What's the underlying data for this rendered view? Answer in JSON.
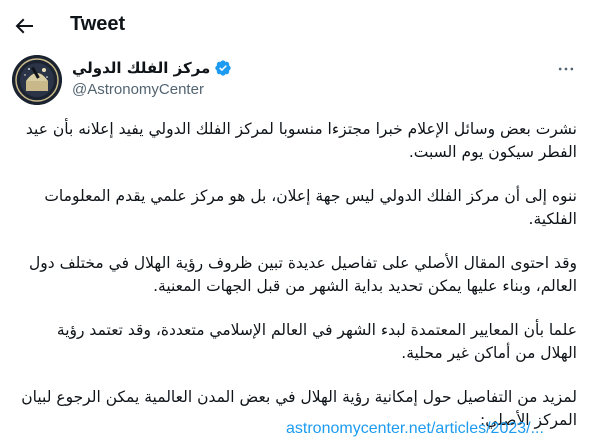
{
  "header": {
    "title": "Tweet",
    "back_icon": "arrow-left-icon"
  },
  "author": {
    "display_name": "مركز الفلك الدولي",
    "handle": "@AstronomyCenter",
    "verified": true,
    "verified_color": "#1d9bf0"
  },
  "tweet": {
    "paragraphs": [
      "نشرت بعض وسائل الإعلام خبرا مجتزءا منسوبا لمركز الفلك الدولي يفيد إعلانه بأن عيد الفطر سيكون يوم السبت.",
      "ننوه إلى أن مركز الفلك الدولي ليس جهة إعلان، بل هو مركز علمي يقدم المعلومات الفلكية.",
      "وقد احتوى المقال الأصلي على تفاصيل عديدة تبين ظروف رؤية الهلال في مختلف دول العالم، وبناء عليها يمكن تحديد بداية الشهر من قبل الجهات المعنية.",
      "علما بأن المعايير المعتمدة لبدء الشهر في العالم الإسلامي متعددة، وقد تعتمد رؤية الهلال من أماكن غير محلية.",
      "لمزيد من التفاصيل حول إمكانية رؤية الهلال في بعض المدن العالمية يمكن الرجوع لبيان المركز الأصلي:"
    ],
    "link": "astronomycenter.net/articles/2023/...",
    "link_color": "#1d9bf0"
  }
}
